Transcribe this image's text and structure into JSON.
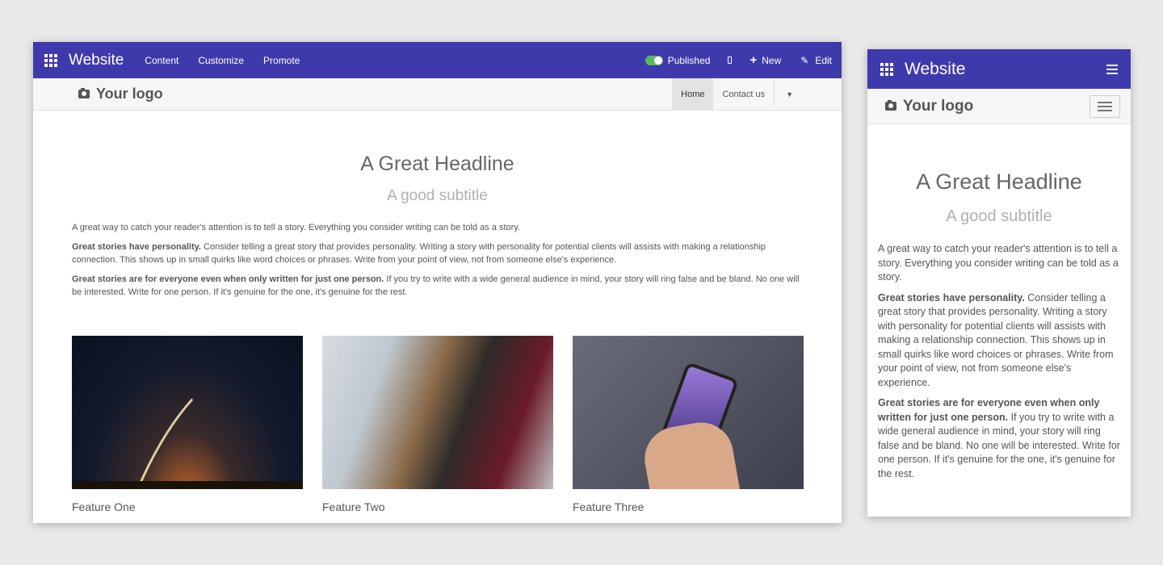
{
  "admin": {
    "brand": "Website",
    "menu": [
      "Content",
      "Customize",
      "Promote"
    ],
    "published_label": "Published",
    "new_label": "New",
    "edit_label": "Edit"
  },
  "site": {
    "logo": "Your logo",
    "nav": [
      "Home",
      "Contact us"
    ]
  },
  "content": {
    "headline": "A Great Headline",
    "subtitle": "A good subtitle",
    "p1": "A great way to catch your reader's attention is to tell a story. Everything you consider writing can be told as a story.",
    "p2_bold": "Great stories have personality.",
    "p2_rest": " Consider telling a great story that provides personality. Writing a story with personality for potential clients will assists with making a relationship connection. This shows up in small quirks like word choices or phrases. Write from your point of view, not from someone else's experience.",
    "p3_bold": "Great stories are for everyone even when only written for just one person.",
    "p3_rest": " If you try to write with a wide general audience in mind, your story will ring false and be bland. No one will be interested. Write for one person. If it's genuine for the one, it's genuine for the rest."
  },
  "features": [
    {
      "title": "Feature One"
    },
    {
      "title": "Feature Two"
    },
    {
      "title": "Feature Three"
    }
  ],
  "colors": {
    "admin_bar": "#3f3aab",
    "toggle_on": "#5cb85c"
  }
}
